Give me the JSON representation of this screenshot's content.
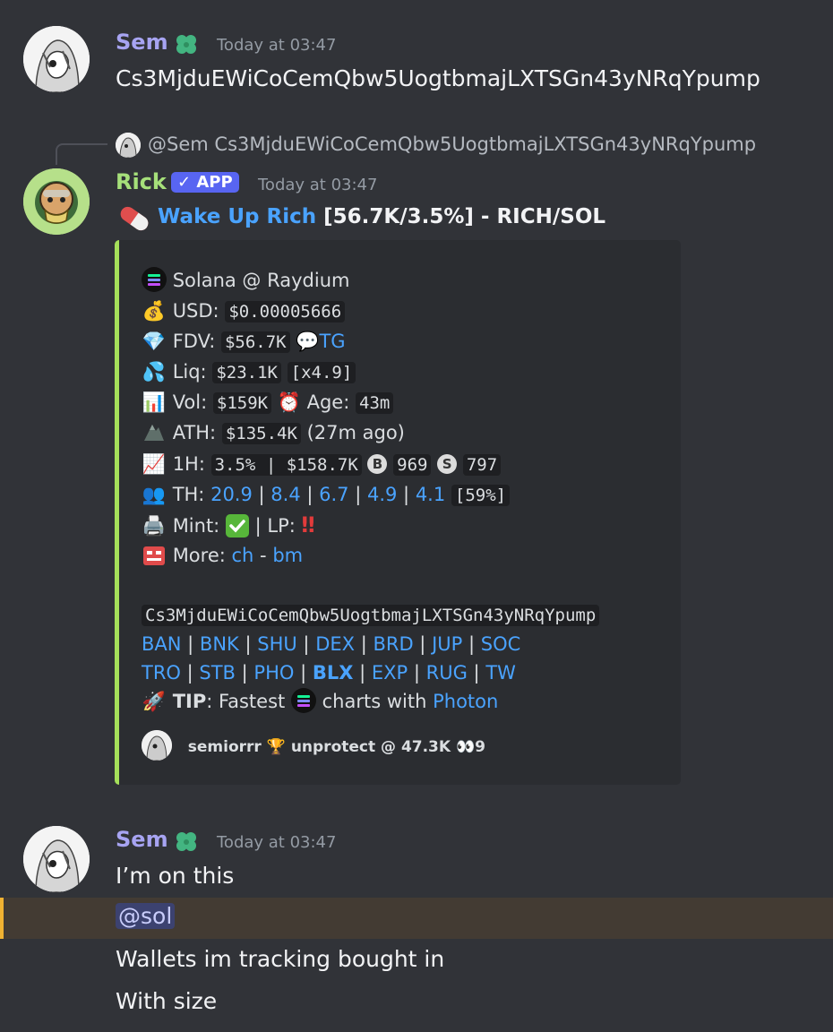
{
  "messages": {
    "m1": {
      "author": "Sem",
      "timestamp": "Today at 03:47",
      "text": "Cs3MjduEWiCoCemQbw5UogtbmajLXTSGn43yNRqYpump"
    },
    "reply": {
      "mention": "@Sem",
      "text": "Cs3MjduEWiCoCemQbw5UogtbmajLXTSGn43yNRqYpump"
    },
    "m2": {
      "author": "Rick",
      "badge": "APP",
      "timestamp": "Today at 03:47",
      "title_link": "Wake Up Rich",
      "title_rest": "[56.7K/3.5%] - RICH/SOL"
    },
    "m3": {
      "author": "Sem",
      "timestamp": "Today at 03:47",
      "line1": "I’m on this",
      "mention": "@sol",
      "line3": "Wallets im tracking bought in",
      "line4": "With size"
    }
  },
  "embed": {
    "chain": "Solana @ Raydium",
    "usd_label": "USD:",
    "usd": "$0.00005666",
    "fdv_label": "FDV:",
    "fdv": "$56.7K",
    "tg": "TG",
    "liq_label": "Liq:",
    "liq": "$23.1K",
    "liq_mult": "[x4.9]",
    "vol_label": "Vol:",
    "vol": "$159K",
    "age_label": "Age:",
    "age": "43m",
    "ath_label": "ATH:",
    "ath": "$135.4K",
    "ath_ago": "(27m ago)",
    "h1_label": "1H:",
    "h1_pct": "3.5%",
    "h1_vol": "$158.7K",
    "buys_letter": "B",
    "buys": "969",
    "sells_letter": "S",
    "sells": "797",
    "th_label": "TH:",
    "th": [
      "20.9",
      "8.4",
      "6.7",
      "4.9",
      "4.1"
    ],
    "th_total": "[59%]",
    "mint_label": "Mint:",
    "lp_label": "| LP:",
    "more_label": "More:",
    "more_links": [
      "ch",
      "bm"
    ],
    "address": "Cs3MjduEWiCoCemQbw5UogtbmajLXTSGn43yNRqYpump",
    "links_row1": [
      "BAN",
      "BNK",
      "SHU",
      "DEX",
      "BRD",
      "JUP",
      "SOC"
    ],
    "links_row2": [
      "TRO",
      "STB",
      "PHO",
      "BLX",
      "EXP",
      "RUG",
      "TW"
    ],
    "tip_label": "TIP",
    "tip_text1": ": Fastest",
    "tip_text2": "charts with",
    "tip_link": "Photon",
    "footer_user": "semiorrr",
    "footer_text": "unprotect @ 47.3K",
    "footer_count": "9"
  },
  "colors": {
    "background": "#313338",
    "embed_bar": "#a5e05a",
    "link": "#4aa3ff",
    "sem_name": "#a7a4f2",
    "rick_name": "#a6e07a",
    "app_badge": "#5865f2"
  }
}
